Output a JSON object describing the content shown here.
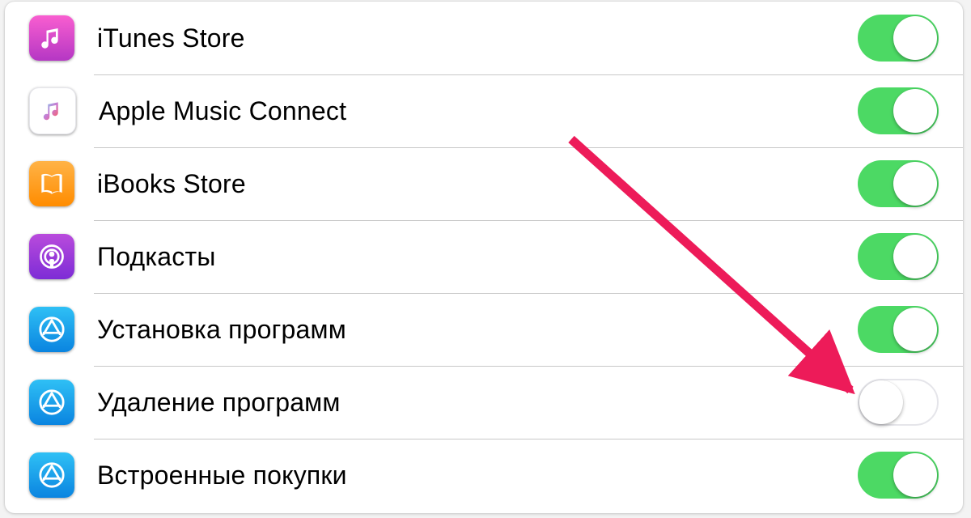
{
  "colors": {
    "toggle_on": "#4cd964",
    "arrow": "#ed1b59"
  },
  "arrow_target_index": 5,
  "rows": [
    {
      "icon": "itunes-icon",
      "label": "iTunes Store",
      "on": true
    },
    {
      "icon": "music-icon",
      "label": "Apple Music Connect",
      "on": true
    },
    {
      "icon": "ibooks-icon",
      "label": "iBooks Store",
      "on": true
    },
    {
      "icon": "podcasts-icon",
      "label": "Подкасты",
      "on": true
    },
    {
      "icon": "appstore-icon",
      "label": "Установка программ",
      "on": true
    },
    {
      "icon": "appstore-icon",
      "label": "Удаление программ",
      "on": false
    },
    {
      "icon": "appstore-icon",
      "label": "Встроенные покупки",
      "on": true
    }
  ]
}
